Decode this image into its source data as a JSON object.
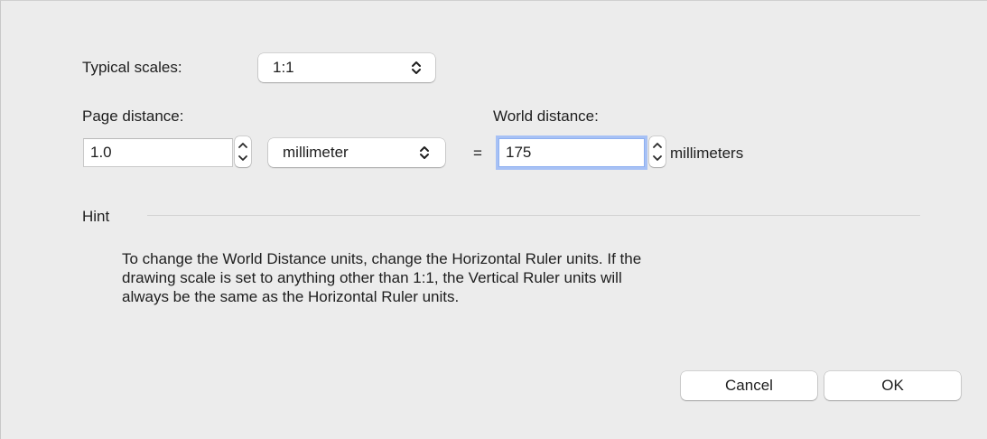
{
  "scales": {
    "label": "Typical scales:",
    "selected": "1:1"
  },
  "page_distance": {
    "label": "Page distance:",
    "value": "1.0",
    "unit_selected": "millimeter"
  },
  "equals": "=",
  "world_distance": {
    "label": "World distance:",
    "value": "175",
    "unit_text": "millimeters"
  },
  "hint": {
    "title": "Hint",
    "line1": "To change the World Distance units, change the Horizontal Ruler units. If the",
    "line2": "drawing scale is set to anything other than 1:1, the Vertical Ruler units will",
    "line3": "always be the same as the Horizontal Ruler units."
  },
  "buttons": {
    "cancel": "Cancel",
    "ok": "OK"
  },
  "icons": {
    "popup": "up-down-chevron-icon",
    "stepper_up": "chevron-up-icon",
    "stepper_down": "chevron-down-icon"
  }
}
